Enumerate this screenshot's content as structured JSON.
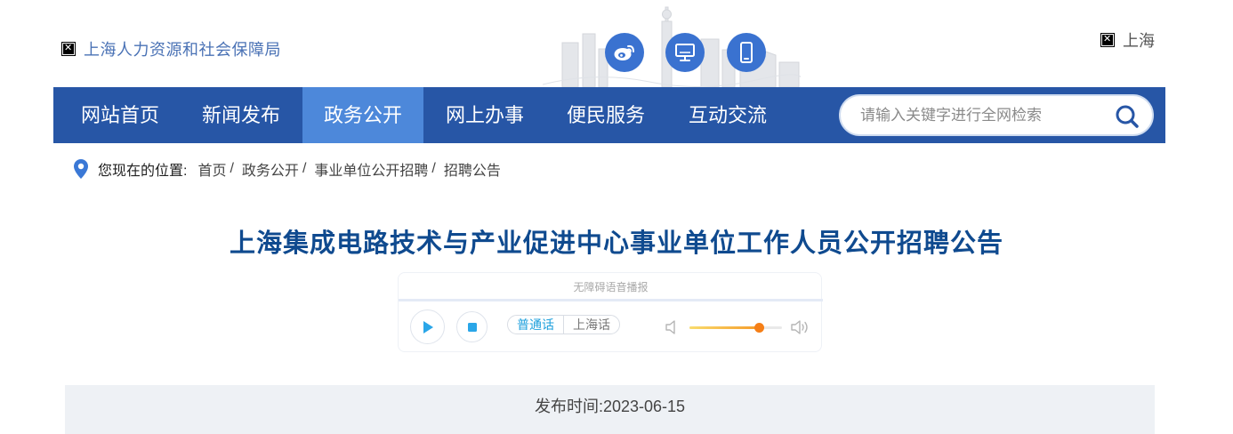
{
  "header": {
    "site_name": "上海人力资源和社会保障局",
    "city_name": "上海",
    "social": [
      {
        "icon": "weibo-icon"
      },
      {
        "icon": "monitor-icon"
      },
      {
        "icon": "mobile-icon"
      }
    ]
  },
  "nav": {
    "items": [
      {
        "label": "网站首页",
        "active": false
      },
      {
        "label": "新闻发布",
        "active": false
      },
      {
        "label": "政务公开",
        "active": true
      },
      {
        "label": "网上办事",
        "active": false
      },
      {
        "label": "便民服务",
        "active": false
      },
      {
        "label": "互动交流",
        "active": false
      }
    ],
    "search_placeholder": "请输入关键字进行全网检索"
  },
  "breadcrumb": {
    "label": "您现在的位置:",
    "items": [
      "首页",
      "政务公开",
      "事业单位公开招聘",
      "招聘公告"
    ],
    "separator": "/"
  },
  "article": {
    "title": "上海集成电路技术与产业促进中心事业单位工作人员公开招聘公告",
    "publish_label": "发布时间:",
    "publish_date": "2023-06-15"
  },
  "player": {
    "label": "无障碍语音播报",
    "languages": [
      "普通话",
      "上海话"
    ],
    "selected_language": "普通话",
    "volume": 0.75
  },
  "colors": {
    "nav_bg": "#2756a6",
    "nav_active": "#4d88da",
    "title": "#0f4a8f",
    "accent": "#3a72d0"
  }
}
